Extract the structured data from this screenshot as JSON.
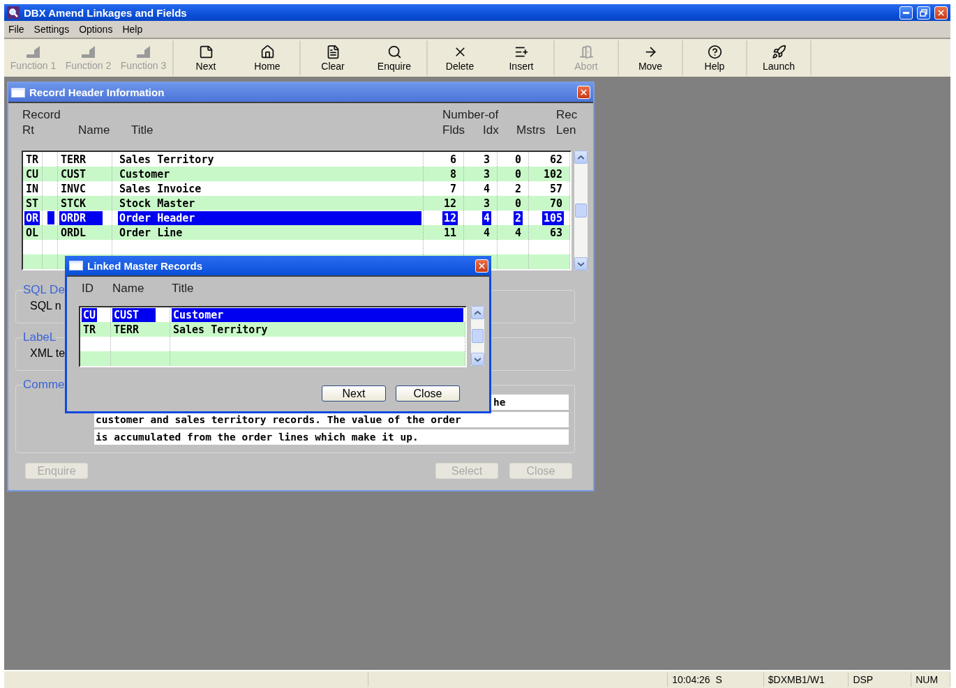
{
  "window": {
    "title": "DBX Amend Linkages and Fields"
  },
  "menu": [
    "File",
    "Settings",
    "Options",
    "Help"
  ],
  "toolbar": [
    [
      {
        "label": "Function 1",
        "disabled": true
      },
      {
        "label": "Function 2",
        "disabled": true
      },
      {
        "label": "Function 3",
        "disabled": true
      }
    ],
    [
      {
        "label": "Next",
        "disabled": false
      },
      {
        "label": "Home",
        "disabled": false
      }
    ],
    [
      {
        "label": "Clear",
        "disabled": false
      },
      {
        "label": "Enquire",
        "disabled": false
      }
    ],
    [
      {
        "label": "Delete",
        "disabled": false
      },
      {
        "label": "Insert",
        "disabled": false
      }
    ],
    [
      {
        "label": "Abort",
        "disabled": true
      }
    ],
    [
      {
        "label": "Move",
        "disabled": false
      }
    ],
    [
      {
        "label": "Help",
        "disabled": false
      }
    ],
    [
      {
        "label": "Launch",
        "disabled": false
      }
    ]
  ],
  "record_window": {
    "title": "Record Header Information",
    "header_groups": [
      "Record",
      "Number-of",
      "Rec"
    ],
    "columns": [
      "Rt",
      "Name",
      "Title",
      "Flds",
      "Idx",
      "Mstrs",
      "Len"
    ],
    "rows": [
      {
        "rt": "TR",
        "name": "TERR",
        "title": "Sales Territory",
        "flds": "6",
        "idx": "3",
        "mstrs": "0",
        "len": "62",
        "selected": false
      },
      {
        "rt": "CU",
        "name": "CUST",
        "title": "Customer",
        "flds": "8",
        "idx": "3",
        "mstrs": "0",
        "len": "102",
        "selected": false
      },
      {
        "rt": "IN",
        "name": "INVC",
        "title": "Sales Invoice",
        "flds": "7",
        "idx": "4",
        "mstrs": "2",
        "len": "57",
        "selected": false
      },
      {
        "rt": "ST",
        "name": "STCK",
        "title": "Stock Master",
        "flds": "12",
        "idx": "3",
        "mstrs": "0",
        "len": "70",
        "selected": false
      },
      {
        "rt": "OR",
        "name": "ORDR",
        "title": "Order Header",
        "flds": "12",
        "idx": "4",
        "mstrs": "2",
        "len": "105",
        "selected": true
      },
      {
        "rt": "OL",
        "name": "ORDL",
        "title": "Order Line",
        "flds": "11",
        "idx": "4",
        "mstrs": "4",
        "len": "63",
        "selected": false
      }
    ],
    "groups": [
      {
        "label": "SQL De",
        "field_label": "SQL n"
      },
      {
        "label": "LabeL",
        "field_label": "XML te"
      }
    ],
    "comments": {
      "label": "Comme",
      "lines": [
        "he",
        "customer and sales territory records. The value of the order",
        "is accumulated from the order lines which make it up."
      ]
    },
    "buttons": [
      {
        "label": "Enquire",
        "disabled": true
      },
      {
        "label": "Select",
        "disabled": true
      },
      {
        "label": "Close",
        "disabled": true
      }
    ]
  },
  "dialog": {
    "title": "Linked Master Records",
    "columns": [
      "ID",
      "Name",
      "Title"
    ],
    "rows": [
      {
        "id": "CU",
        "name": "CUST",
        "title": "Customer",
        "selected": true
      },
      {
        "id": "TR",
        "name": "TERR",
        "title": "Sales Territory",
        "selected": false
      }
    ],
    "buttons": [
      {
        "label": "Next",
        "disabled": false
      },
      {
        "label": "Close",
        "disabled": false
      }
    ]
  },
  "status_bar": [
    "10:04:26  S",
    "$DXMB1/W1",
    "DSP",
    "NUM"
  ]
}
